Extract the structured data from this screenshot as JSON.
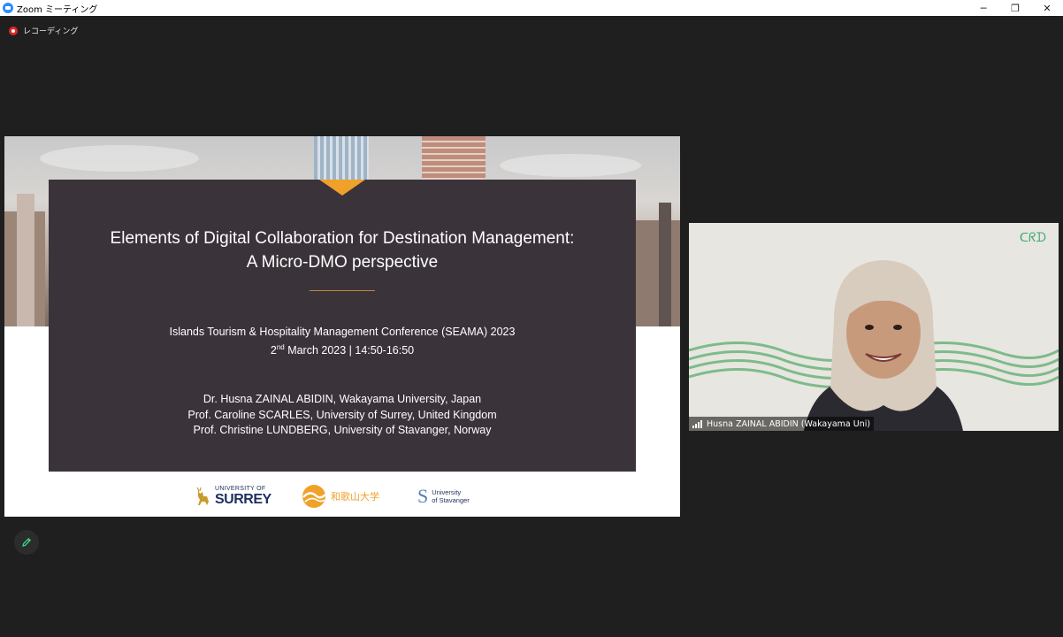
{
  "window": {
    "title": "Zoom ミーティング",
    "minimize_glyph": "─",
    "restore_glyph": "❐",
    "close_glyph": "✕"
  },
  "recording": {
    "label": "レコーディング"
  },
  "slide": {
    "title_line1": "Elements of Digital Collaboration for Destination Management:",
    "title_line2": "A Micro-DMO perspective",
    "conference": "Islands Tourism & Hospitality Management Conference (SEAMA) 2023",
    "date_day": "2",
    "date_suffix": "nd",
    "date_rest": " March 2023 | 14:50-16:50",
    "authors": [
      "Dr. Husna ZAINAL ABIDIN, Wakayama University, Japan",
      "Prof. Caroline SCARLES, University of Surrey, United Kingdom",
      "Prof. Christine LUNDBERG, University of Stavanger, Norway"
    ],
    "logos": {
      "surrey_small": "UNIVERSITY OF",
      "surrey_big": "SURREY",
      "wakayama": "和歌山大学",
      "stavanger_line1": "University",
      "stavanger_line2": "of Stavanger"
    }
  },
  "participant": {
    "name": "Husna ZAINAL ABIDIN (Wakayama Uni)",
    "background_logo": "ᑕᖇᗪ"
  },
  "colors": {
    "accent_orange": "#f0a12a",
    "slide_panel": "#3b333a",
    "recording_red": "#e02828",
    "pen_green": "#3ddc84"
  },
  "icons": [
    "zoom-logo-icon",
    "recording-icon",
    "signal-icon",
    "pen-icon"
  ]
}
